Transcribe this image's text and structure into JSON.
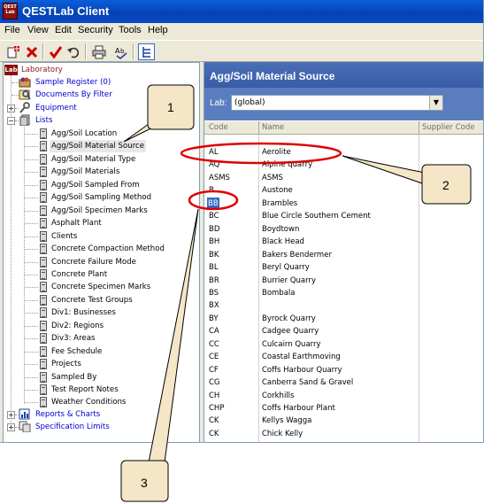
{
  "window": {
    "title": "QESTLab Client",
    "app_icon_text": "QEST Lab"
  },
  "menu": [
    "File",
    "View",
    "Edit",
    "Security",
    "Tools",
    "Help"
  ],
  "toolbar_icons": [
    "new-record-icon",
    "delete-icon",
    "save-check-icon",
    "undo-icon",
    "print-icon",
    "spell-check-icon",
    "tree-toggle-icon"
  ],
  "tree": {
    "root": "Laboratory",
    "root_badge": "Lab",
    "top_items": [
      {
        "label": "Sample Register (0)"
      },
      {
        "label": "Documents By Filter"
      },
      {
        "label": "Equipment"
      },
      {
        "label": "Lists"
      }
    ],
    "lists": [
      "Agg/Soil Location",
      "Agg/Soil Material Source",
      "Agg/Soil Material Type",
      "Agg/Soil Materials",
      "Agg/Soil Sampled From",
      "Agg/Soil Sampling Method",
      "Agg/Soil Specimen Marks",
      "Asphalt Plant",
      "Clients",
      "Concrete Compaction Method",
      "Concrete Failure Mode",
      "Concrete Plant",
      "Concrete Specimen Marks",
      "Concrete Test Groups",
      "Div1: Businesses",
      "Div2: Regions",
      "Div3: Areas",
      "Fee Schedule",
      "Projects",
      "Sampled By",
      "Test Report Notes",
      "Weather Conditions"
    ],
    "bottom_items": [
      "Reports & Charts",
      "Specification Limits"
    ],
    "selected": "Agg/Soil Material Source"
  },
  "panel": {
    "title": "Agg/Soil Material Source",
    "lab_label": "Lab:",
    "lab_value": "(global)",
    "columns": [
      "Code",
      "Name",
      "Supplier Code"
    ],
    "rows": [
      {
        "code": "AL",
        "name": "Aerolite"
      },
      {
        "code": "AQ",
        "name": "Alpine quarry"
      },
      {
        "code": "ASMS",
        "name": "ASMS"
      },
      {
        "code": "B",
        "name": "Austone"
      },
      {
        "code": "BB",
        "name": "Brambles"
      },
      {
        "code": "BC",
        "name": "Blue Circle Southern Cement"
      },
      {
        "code": "BD",
        "name": "Boydtown"
      },
      {
        "code": "BH",
        "name": "Black Head"
      },
      {
        "code": "BK",
        "name": "Bakers Bendermer"
      },
      {
        "code": "BL",
        "name": "Beryl Quarry"
      },
      {
        "code": "BR",
        "name": "Burrier Quarry"
      },
      {
        "code": "BS",
        "name": "Bombala"
      },
      {
        "code": "BX",
        "name": ""
      },
      {
        "code": "BY",
        "name": "Byrock Quarry"
      },
      {
        "code": "CA",
        "name": "Cadgee Quarry"
      },
      {
        "code": "CC",
        "name": "Culcairn Quarry"
      },
      {
        "code": "CE",
        "name": "Coastal Earthmoving"
      },
      {
        "code": "CF",
        "name": "Coffs Harbour Quarry"
      },
      {
        "code": "CG",
        "name": "Canberra Sand & Gravel"
      },
      {
        "code": "CH",
        "name": "Corkhills"
      },
      {
        "code": "CHP",
        "name": "Coffs Harbour Plant"
      },
      {
        "code": "CK",
        "name": "Kellys Wagga"
      },
      {
        "code": "CK",
        "name": "Chick Kelly"
      }
    ],
    "selected_code": "BB"
  },
  "callouts": [
    "1",
    "2",
    "3"
  ],
  "colors": {
    "title_blue": "#0442b4",
    "panel_blue": "#3a5ca8",
    "annotation_red": "#e00000",
    "callout_fill": "#f5e6c8",
    "selection_blue": "#316ac5"
  }
}
